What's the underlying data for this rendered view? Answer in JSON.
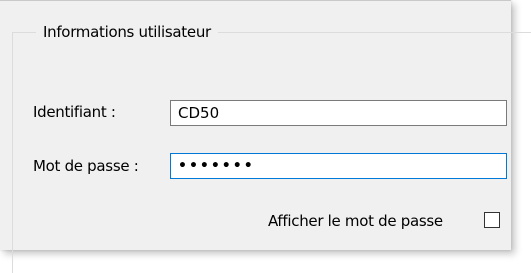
{
  "groupbox": {
    "title": "Informations utilisateur"
  },
  "form": {
    "username_label": "Identifiant :",
    "username_value": "CD50",
    "password_label": "Mot de passe :",
    "password_value": "•••••••",
    "show_password_label": "Afficher le mot de passe",
    "show_password_checked": false
  },
  "colors": {
    "panel_background": "#f0f0f0",
    "focus_border": "#0078d7"
  }
}
